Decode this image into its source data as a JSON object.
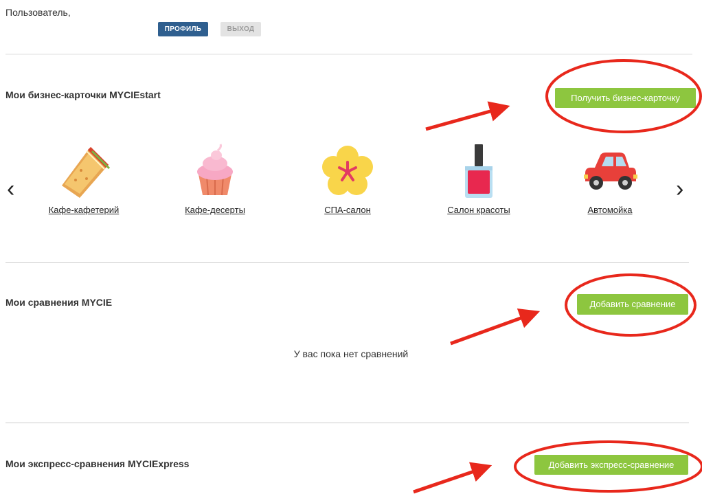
{
  "header": {
    "user_label": "Пользователь,",
    "profile_button": "ПРОФИЛЬ",
    "logout_button": "ВЫХОД"
  },
  "business_cards": {
    "title": "Мои бизнес-карточки MYCIEstart",
    "get_button": "Получить бизнес-карточку",
    "prev_arrow": "‹",
    "next_arrow": "›",
    "items": [
      {
        "label": "Кафе-кафетерий",
        "icon": "sandwich-icon"
      },
      {
        "label": "Кафе-десерты",
        "icon": "cupcake-icon"
      },
      {
        "label": "СПА-салон",
        "icon": "flower-icon"
      },
      {
        "label": "Салон красоты",
        "icon": "nail-polish-icon"
      },
      {
        "label": "Автомойка",
        "icon": "car-icon"
      }
    ]
  },
  "comparisons": {
    "title": "Мои сравнения MYCIE",
    "add_button": "Добавить сравнение",
    "empty_message": "У вас пока нет сравнений"
  },
  "express": {
    "title": "Мои экспресс-сравнения MYCIExpress",
    "add_button": "Добавить экспресс-сравнение"
  },
  "colors": {
    "primary": "#2f5f8f",
    "accent_green": "#8dc63f",
    "annotation_red": "#e8281c"
  }
}
